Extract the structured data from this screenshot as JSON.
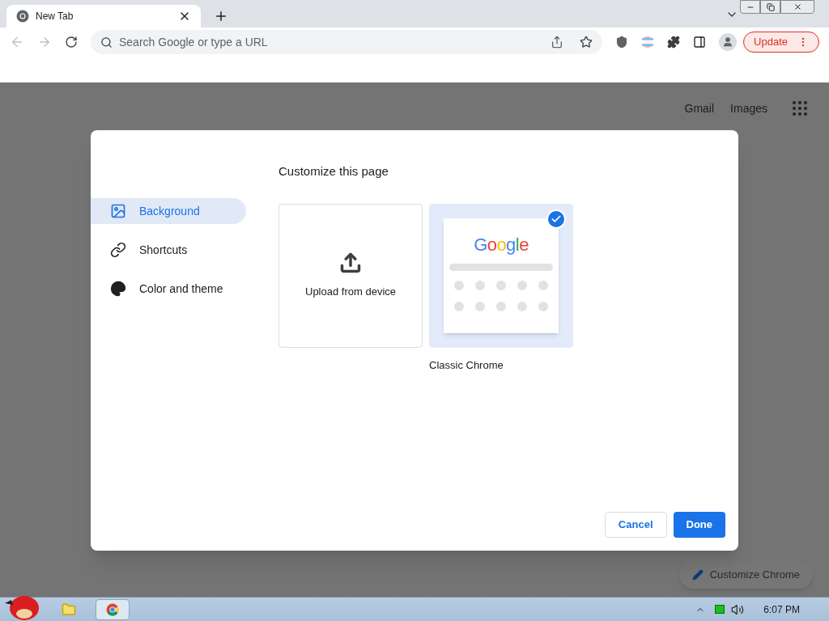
{
  "browser": {
    "tab_title": "New Tab",
    "address_placeholder": "Search Google or type a URL",
    "update_button": "Update"
  },
  "page": {
    "links": [
      "Gmail",
      "Images"
    ],
    "customize_button": "Customize Chrome"
  },
  "dialog": {
    "title": "Customize this page",
    "menu": [
      {
        "label": "Background",
        "selected": true
      },
      {
        "label": "Shortcuts",
        "selected": false
      },
      {
        "label": "Color and theme",
        "selected": false
      }
    ],
    "tiles": [
      {
        "kind": "upload",
        "label": "Upload from device",
        "selected": false
      },
      {
        "kind": "theme",
        "label": "Classic Chrome",
        "logo": "Google",
        "selected": true
      }
    ],
    "buttons": [
      {
        "kind": "secondary",
        "label": "Cancel"
      },
      {
        "kind": "primary",
        "label": "Done"
      }
    ]
  },
  "taskbar": {
    "clock": "6:07 PM"
  }
}
